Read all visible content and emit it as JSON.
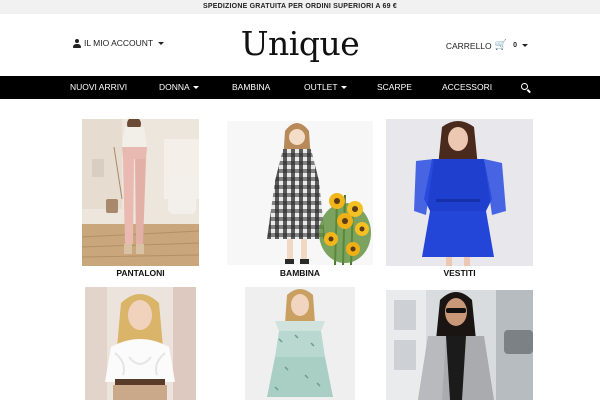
{
  "promo": {
    "text": "SPEDIZIONE GRATUITA PER ORDINI SUPERIORI A 69 €"
  },
  "header": {
    "account_label": "IL MIO ACCOUNT",
    "logo_text": "Unique",
    "cart_label": "CARRELLO",
    "cart_count": "0"
  },
  "nav": {
    "items": [
      {
        "label": "NUOVI ARRIVI",
        "dropdown": false
      },
      {
        "label": "DONNA",
        "dropdown": true
      },
      {
        "label": "BAMBINA",
        "dropdown": false
      },
      {
        "label": "OUTLET",
        "dropdown": true
      },
      {
        "label": "SCARPE",
        "dropdown": false
      },
      {
        "label": "ACCESSORI",
        "dropdown": false
      }
    ],
    "search_icon": "search-icon"
  },
  "categories": [
    {
      "label": "PANTALONI",
      "image": "woman in pink trousers"
    },
    {
      "label": "BAMBINA",
      "image": "girl in plaid dress with sunflowers"
    },
    {
      "label": "VESTITI",
      "image": "woman in blue dress"
    },
    {
      "label": "",
      "image": "woman in white ruffled blouse"
    },
    {
      "label": "",
      "image": "woman in mint floral dress"
    },
    {
      "label": "",
      "image": "woman in grey coat"
    }
  ],
  "colors": {
    "nav_bg": "#000000",
    "promo_bg": "#f1f1f1",
    "accent_blue": "#1f3fcf"
  }
}
